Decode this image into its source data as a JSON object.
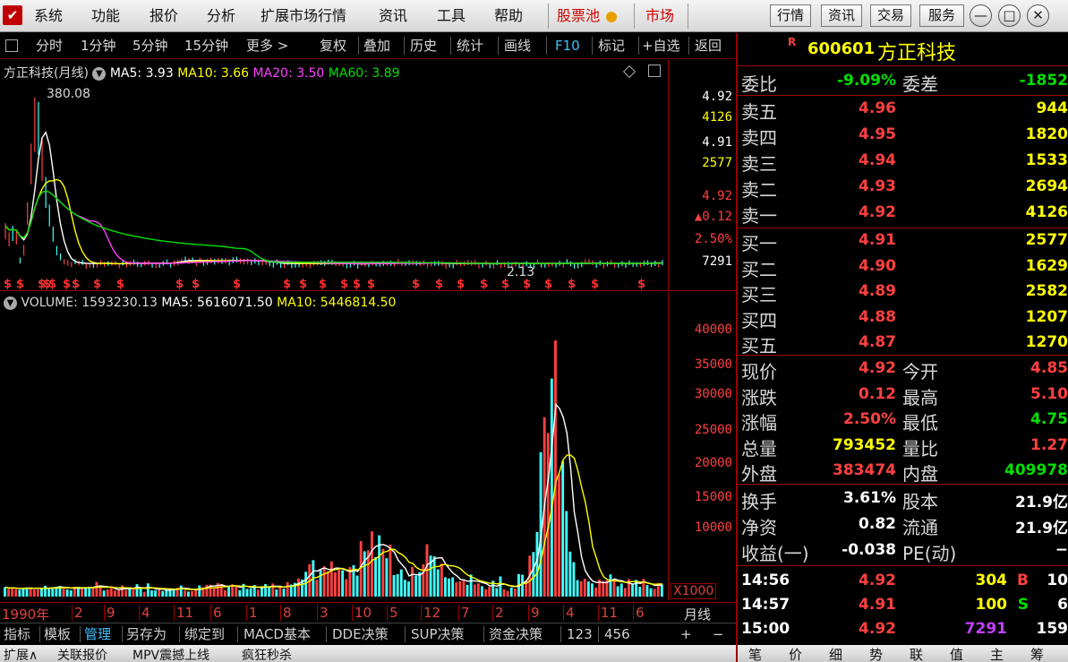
{
  "menubar": {
    "logo_glyph": "✔",
    "items": [
      "系统",
      "功能",
      "报价",
      "分析",
      "扩展市场行情",
      "资讯",
      "工具",
      "帮助"
    ],
    "stock_pool": "股票池",
    "market": "市场",
    "sys_buttons": [
      "行情",
      "资讯",
      "交易",
      "服务"
    ],
    "win_minimize": "—",
    "win_restore": "□",
    "win_close": "✕"
  },
  "toolbar": {
    "items": [
      "分时",
      "1分钟",
      "5分钟",
      "15分钟",
      "更多 >",
      "复权",
      "叠加",
      "历史",
      "统计",
      "画线",
      "F10",
      "标记",
      "+自选",
      "返回"
    ]
  },
  "kline": {
    "title": "方正科技(月线)",
    "ma5": "MA5: 3.93",
    "ma10": "MA10: 3.66",
    "ma20": "MA20: 3.50",
    "ma60": "MA60: 3.89",
    "high_label": "380.08",
    "low_label": "2.13",
    "axis_values": [
      "4.92",
      "4126",
      "4.91",
      "2577",
      "4.92",
      "▲0.12",
      "2.50%",
      "7291"
    ]
  },
  "volume": {
    "title": "VOLUME: 1593230.13",
    "ma5": "MA5: 5616071.50",
    "ma10": "MA10: 5446814.50",
    "axis_values": [
      "40000",
      "35000",
      "30000",
      "25000",
      "20000",
      "15000",
      "10000"
    ],
    "unit": "X1000"
  },
  "time_axis": {
    "labels": [
      "1990年",
      "2",
      "9",
      "4",
      "11",
      "6",
      "1",
      "8",
      "3",
      "10",
      "5",
      "12",
      "7",
      "2",
      "9",
      "4",
      "11",
      "6"
    ],
    "period": "月线"
  },
  "bottom_tabs": [
    "指标",
    "模板",
    "管理",
    "另存为",
    "绑定到",
    "MACD基本",
    "DDE决策",
    "SUP决策",
    "资金决策",
    "123",
    "456",
    "+",
    "−"
  ],
  "status_bar": [
    "扩展∧",
    "关联报价",
    "MPV震撼上线",
    "疯狂秒杀"
  ],
  "quote": {
    "badge": "R",
    "code": "600601",
    "name": "方正科技",
    "weibi_label": "委比",
    "weibi": "-9.09%",
    "weicha_label": "委差",
    "weicha": "-1852",
    "asks": [
      {
        "label": "卖五",
        "price": "4.96",
        "vol": "944"
      },
      {
        "label": "卖四",
        "price": "4.95",
        "vol": "1820"
      },
      {
        "label": "卖三",
        "price": "4.94",
        "vol": "1533"
      },
      {
        "label": "卖二",
        "price": "4.93",
        "vol": "2694"
      },
      {
        "label": "卖一",
        "price": "4.92",
        "vol": "4126"
      }
    ],
    "bids": [
      {
        "label": "买一",
        "price": "4.91",
        "vol": "2577"
      },
      {
        "label": "买二",
        "price": "4.90",
        "vol": "1629"
      },
      {
        "label": "买三",
        "price": "4.89",
        "vol": "2582"
      },
      {
        "label": "买四",
        "price": "4.88",
        "vol": "1207"
      },
      {
        "label": "买五",
        "price": "4.87",
        "vol": "1270"
      }
    ],
    "stats": [
      {
        "l1": "现价",
        "v1": "4.92",
        "c1": "red",
        "l2": "今开",
        "v2": "4.85",
        "c2": "red"
      },
      {
        "l1": "涨跌",
        "v1": "0.12",
        "c1": "red",
        "l2": "最高",
        "v2": "5.10",
        "c2": "red"
      },
      {
        "l1": "涨幅",
        "v1": "2.50%",
        "c1": "red",
        "l2": "最低",
        "v2": "4.75",
        "c2": "green"
      },
      {
        "l1": "总量",
        "v1": "793452",
        "c1": "yellow",
        "l2": "量比",
        "v2": "1.27",
        "c2": "red"
      },
      {
        "l1": "外盘",
        "v1": "383474",
        "c1": "red",
        "l2": "内盘",
        "v2": "409978",
        "c2": "green"
      }
    ],
    "fundamentals": [
      {
        "l1": "换手",
        "v1": "3.61%",
        "l2": "股本",
        "v2": "21.9亿"
      },
      {
        "l1": "净资",
        "v1": "0.82",
        "l2": "流通",
        "v2": "21.9亿"
      },
      {
        "l1": "收益(一)",
        "v1": "-0.038",
        "l2": "PE(动)",
        "v2": "−"
      }
    ],
    "ticks": [
      {
        "time": "14:56",
        "price": "4.92",
        "vol": "304",
        "vcolor": "yellow",
        "side": "B",
        "scolor": "red",
        "num": "10"
      },
      {
        "time": "14:57",
        "price": "4.91",
        "vol": "100",
        "vcolor": "yellow",
        "side": "S",
        "scolor": "green",
        "num": "6"
      },
      {
        "time": "15:00",
        "price": "4.92",
        "vol": "7291",
        "vcolor": "purple",
        "side": "",
        "scolor": "red",
        "num": "159"
      }
    ],
    "tabs": [
      "笔",
      "价",
      "细",
      "势",
      "联",
      "值",
      "主",
      "筹"
    ]
  },
  "colors": {
    "up": "#ff4040",
    "down": "#40ffff",
    "ma5": "#ffffff",
    "ma10": "#ffff00",
    "ma20": "#ff40ff",
    "ma60": "#00e000"
  }
}
